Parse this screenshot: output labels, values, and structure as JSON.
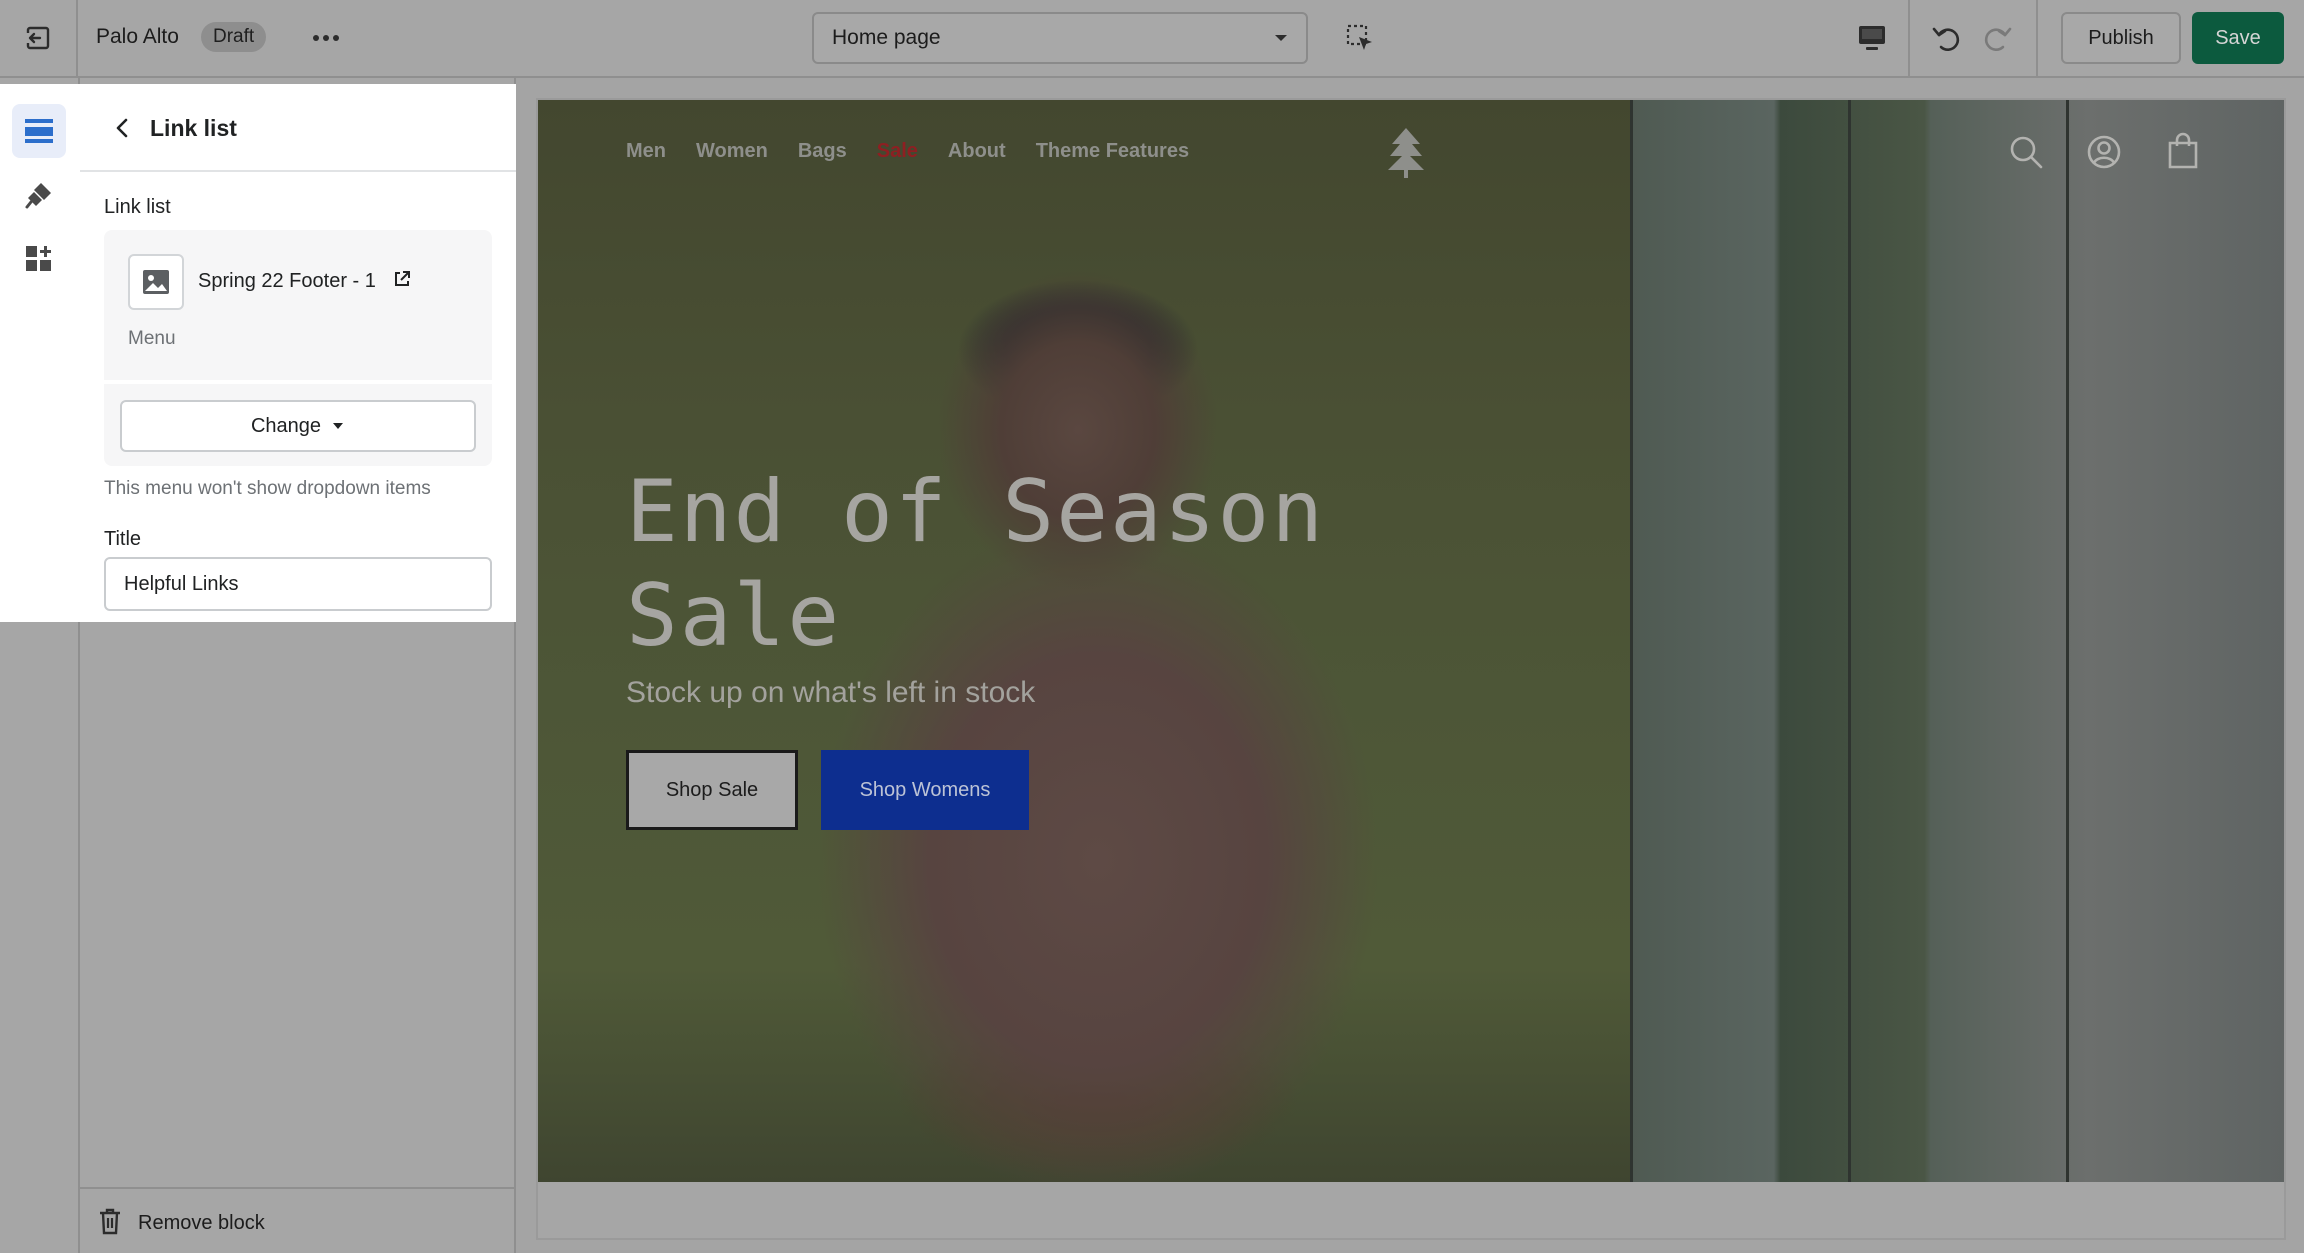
{
  "topbar": {
    "store_name": "Palo Alto",
    "status_badge": "Draft",
    "page_selector": "Home page",
    "publish_label": "Publish",
    "save_label": "Save"
  },
  "sidebar_rail": {
    "items": [
      "sections-icon",
      "theme-settings-icon",
      "app-blocks-icon"
    ],
    "active": "sections-icon"
  },
  "panel": {
    "title": "Link list",
    "field_label": "Link list",
    "menu_name": "Spring 22 Footer - 1",
    "menu_type": "Menu",
    "change_label": "Change",
    "help_text": "This menu won't show dropdown items",
    "title_label": "Title",
    "title_value": "Helpful Links",
    "remove_label": "Remove block"
  },
  "preview": {
    "nav": [
      "Men",
      "Women",
      "Bags",
      "Sale",
      "About",
      "Theme Features"
    ],
    "hero_title": "End of Season Sale",
    "hero_subtitle": "Stock up on what's left in stock",
    "primary_button": "Shop Sale",
    "secondary_button": "Shop Womens"
  },
  "colors": {
    "save_button": "#0c5a3e",
    "secondary_button": "#0d2e8f",
    "sale_link": "#8e1f22"
  }
}
